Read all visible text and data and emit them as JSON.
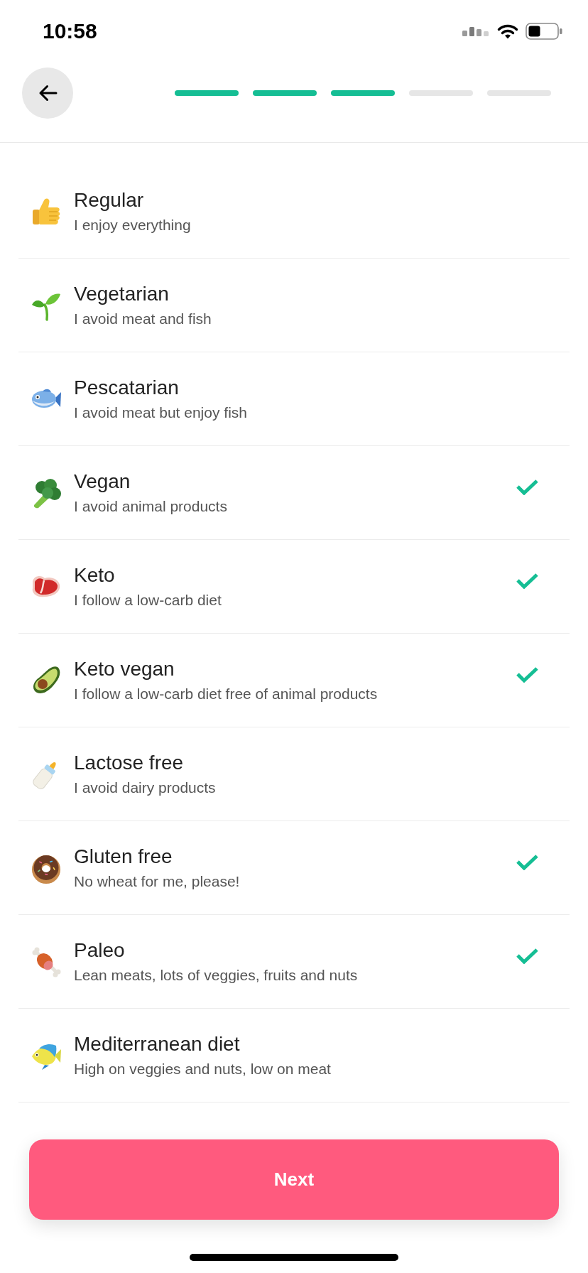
{
  "status_bar": {
    "time": "10:58"
  },
  "progress": {
    "steps": [
      {
        "completed": true
      },
      {
        "completed": true
      },
      {
        "completed": true
      },
      {
        "completed": false
      },
      {
        "completed": false
      }
    ]
  },
  "options": [
    {
      "title": "Regular",
      "subtitle": "I enjoy everything",
      "selected": false
    },
    {
      "title": "Vegetarian",
      "subtitle": "I avoid meat and fish",
      "selected": false
    },
    {
      "title": "Pescatarian",
      "subtitle": "I avoid meat but enjoy fish",
      "selected": false
    },
    {
      "title": "Vegan",
      "subtitle": "I avoid animal products",
      "selected": true
    },
    {
      "title": "Keto",
      "subtitle": "I follow a low-carb diet",
      "selected": true
    },
    {
      "title": "Keto vegan",
      "subtitle": "I follow a low-carb diet free of animal products",
      "selected": true
    },
    {
      "title": "Lactose free",
      "subtitle": "I avoid dairy products",
      "selected": false
    },
    {
      "title": "Gluten free",
      "subtitle": "No wheat for me, please!",
      "selected": true
    },
    {
      "title": "Paleo",
      "subtitle": "Lean meats, lots of veggies, fruits and nuts",
      "selected": true
    },
    {
      "title": "Mediterranean diet",
      "subtitle": "High on veggies and nuts, low on meat",
      "selected": false
    }
  ],
  "next_button": {
    "label": "Next"
  }
}
